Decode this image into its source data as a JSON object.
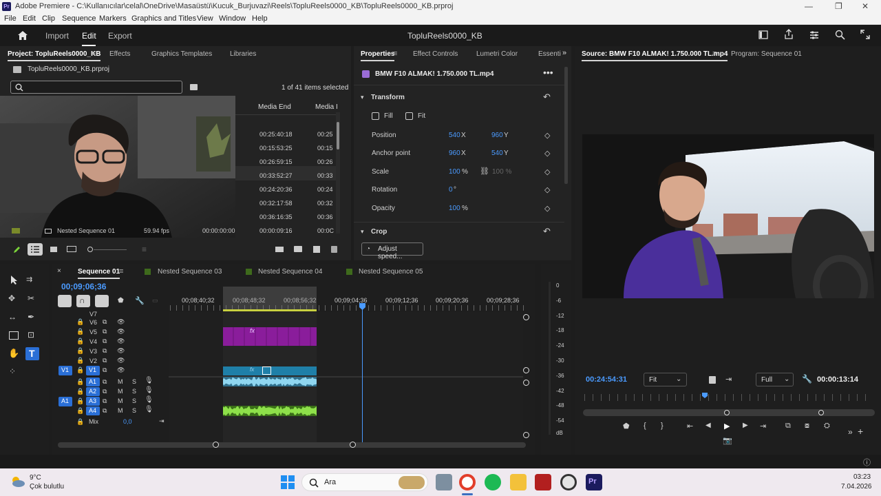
{
  "window": {
    "app_icon": "Pr",
    "title": "Adobe Premiere - C:\\Kullanıcılar\\celal\\OneDrive\\Masaüstü\\Kucuk_Burjuvazi\\Reels\\TopluReels0000_KB\\TopluReels0000_KB.prproj"
  },
  "menu": [
    "File",
    "Edit",
    "Clip",
    "Sequence",
    "Markers",
    "Graphics and Titles",
    "View",
    "Window",
    "Help"
  ],
  "header": {
    "tabs": [
      "Import",
      "Edit",
      "Export"
    ],
    "active_tab": "Edit",
    "project_name": "TopluReels0000_KB"
  },
  "project_panel": {
    "tabs": [
      "Project: TopluReels0000_KB",
      "Effects",
      "Graphics Templates",
      "Libraries"
    ],
    "file": "TopluReels0000_KB.prproj",
    "items_count": "1 of 41 items selected",
    "columns": [
      "Media End",
      "Media I"
    ],
    "media_end": [
      "00:25:40:18",
      "00:15:53:25",
      "00:26:59:15",
      "00:33:52:27",
      "00:24:20:36",
      "00:32:17:58",
      "00:36:16:35",
      "00:00:09:16"
    ],
    "media_in_cut": [
      "00:25",
      "00:15",
      "00:26",
      "00:33",
      "00:24",
      "00:32",
      "00:36",
      "00:0C"
    ],
    "bottom_row": {
      "name": "Nested Sequence 01",
      "fps": "59.94 fps",
      "start": "00:00:00:00"
    }
  },
  "properties_panel": {
    "tabs": [
      "Properties",
      "Effect Controls",
      "Lumetri Color",
      "Essenti"
    ],
    "clip_name": "BMW F10 ALMAK! 1.750.000 TL.mp4",
    "section_transform": "Transform",
    "fill_label": "Fill",
    "fit_label": "Fit",
    "rows": [
      {
        "label": "Position",
        "v1": "540",
        "u1": "X",
        "v2": "960",
        "u2": "Y"
      },
      {
        "label": "Anchor point",
        "v1": "960",
        "u1": "X",
        "v2": "540",
        "u2": "Y"
      },
      {
        "label": "Scale",
        "v1": "100",
        "u1": "%",
        "v2": "100 %",
        "u2": ""
      },
      {
        "label": "Rotation",
        "v1": "0",
        "u1": "°",
        "v2": "",
        "u2": ""
      },
      {
        "label": "Opacity",
        "v1": "100",
        "u1": "%",
        "v2": "",
        "u2": ""
      }
    ],
    "section_crop": "Crop",
    "adjust_speed": "Adjust speed..."
  },
  "source_panel": {
    "tabs": [
      "Source: BMW F10 ALMAK! 1.750.000 TL.mp4",
      "Program: Sequence 01"
    ],
    "timecode_left": "00:24:54:31",
    "zoom": "Fit",
    "quality": "Full",
    "timecode_right": "00:00:13:14"
  },
  "timeline": {
    "tabs": [
      "Sequence 01",
      "Nested Sequence 03",
      "Nested Sequence 04",
      "Nested Sequence 05"
    ],
    "timecode": "00;09;06;36",
    "ruler": [
      "00;08;40;32",
      "00;08;48;32",
      "00;08;56;32",
      "00;09;04;36",
      "00;09;12;36",
      "00;09;20;36",
      "00;09;28;36"
    ],
    "video_tracks": [
      "V7",
      "V6",
      "V5",
      "V4",
      "V3",
      "V2",
      "V1"
    ],
    "audio_tracks": [
      "A1",
      "A2",
      "A3",
      "A4"
    ],
    "source_v": "V1",
    "source_a": "A1",
    "mix_label": "Mix",
    "mix_value": "0,0",
    "fx_label": "fx",
    "meter_ticks": [
      "0",
      "-6",
      "-12",
      "-18",
      "-24",
      "-30",
      "-36",
      "-42",
      "-48",
      "-54",
      "dB"
    ]
  },
  "taskbar": {
    "temp": "9°C",
    "weather": "Çok bulutlu",
    "search": "Ara",
    "time": "03:23",
    "date": "7.04.2026"
  },
  "colors": {
    "accent": "#4b9bff",
    "purple_clip": "#8a1d9b",
    "teal_clip": "#1f7fa8",
    "audio_blue": "#5fb7d8",
    "audio_green": "#7bd33a"
  }
}
